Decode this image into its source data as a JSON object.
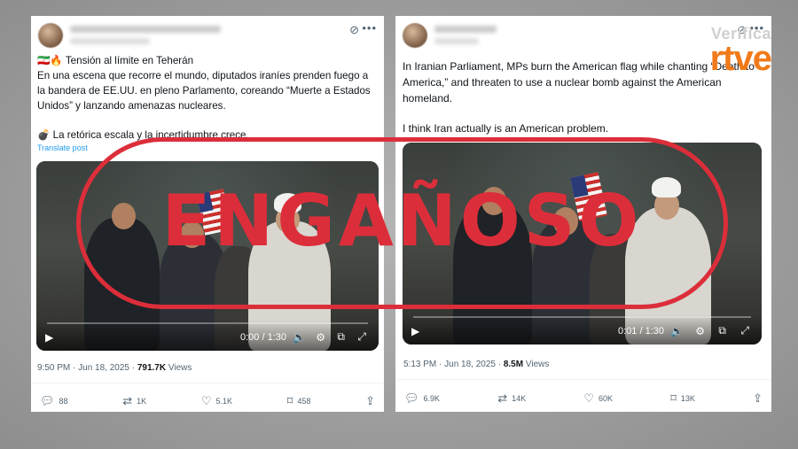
{
  "left_tweet": {
    "title_line": "🇮🇷🔥 Tensión al límite en Teherán",
    "body": "En una escena que recorre el mundo, diputados iraníes prenden fuego a la bandera de EE.UU. en pleno Parlamento, coreando “Muerte a Estados Unidos” y lanzando amenazas nucleares.",
    "body2": "💣 La retórica escala y la incertidumbre crece.",
    "translate": "Translate post",
    "video_time": "0:00 / 1:30",
    "timestamp": "9:50 PM · Jun 18, 2025 · ",
    "views_count": "791.7K",
    "views_label": " Views",
    "replies": "88",
    "reposts": "1K",
    "likes": "5.1K",
    "bookmarks": "458"
  },
  "right_tweet": {
    "body": "In Iranian Parliament, MPs burn the American flag while chanting “Death to America,” and threaten to use a nuclear bomb against the American homeland.",
    "body2": "I think Iran actually is an American problem.",
    "video_time": "0:01 / 1:30",
    "timestamp": "5:13 PM · Jun 18, 2025 · ",
    "views_count": "8.5M",
    "views_label": " Views",
    "replies": "6.9K",
    "reposts": "14K",
    "likes": "60K",
    "bookmarks": "13K"
  },
  "stamp": {
    "text": "ENGAÑOSO",
    "color": "#dc2e3a"
  },
  "brand": {
    "verifica": "Verifica",
    "rtve": "rtve",
    "color": "#f07a1a"
  },
  "icons": [
    "grok-icon",
    "more-icon",
    "play-icon",
    "volume-icon",
    "settings-icon",
    "pip-icon",
    "fullscreen-icon",
    "reply-icon",
    "repost-icon",
    "like-icon",
    "bookmark-icon",
    "share-icon"
  ]
}
